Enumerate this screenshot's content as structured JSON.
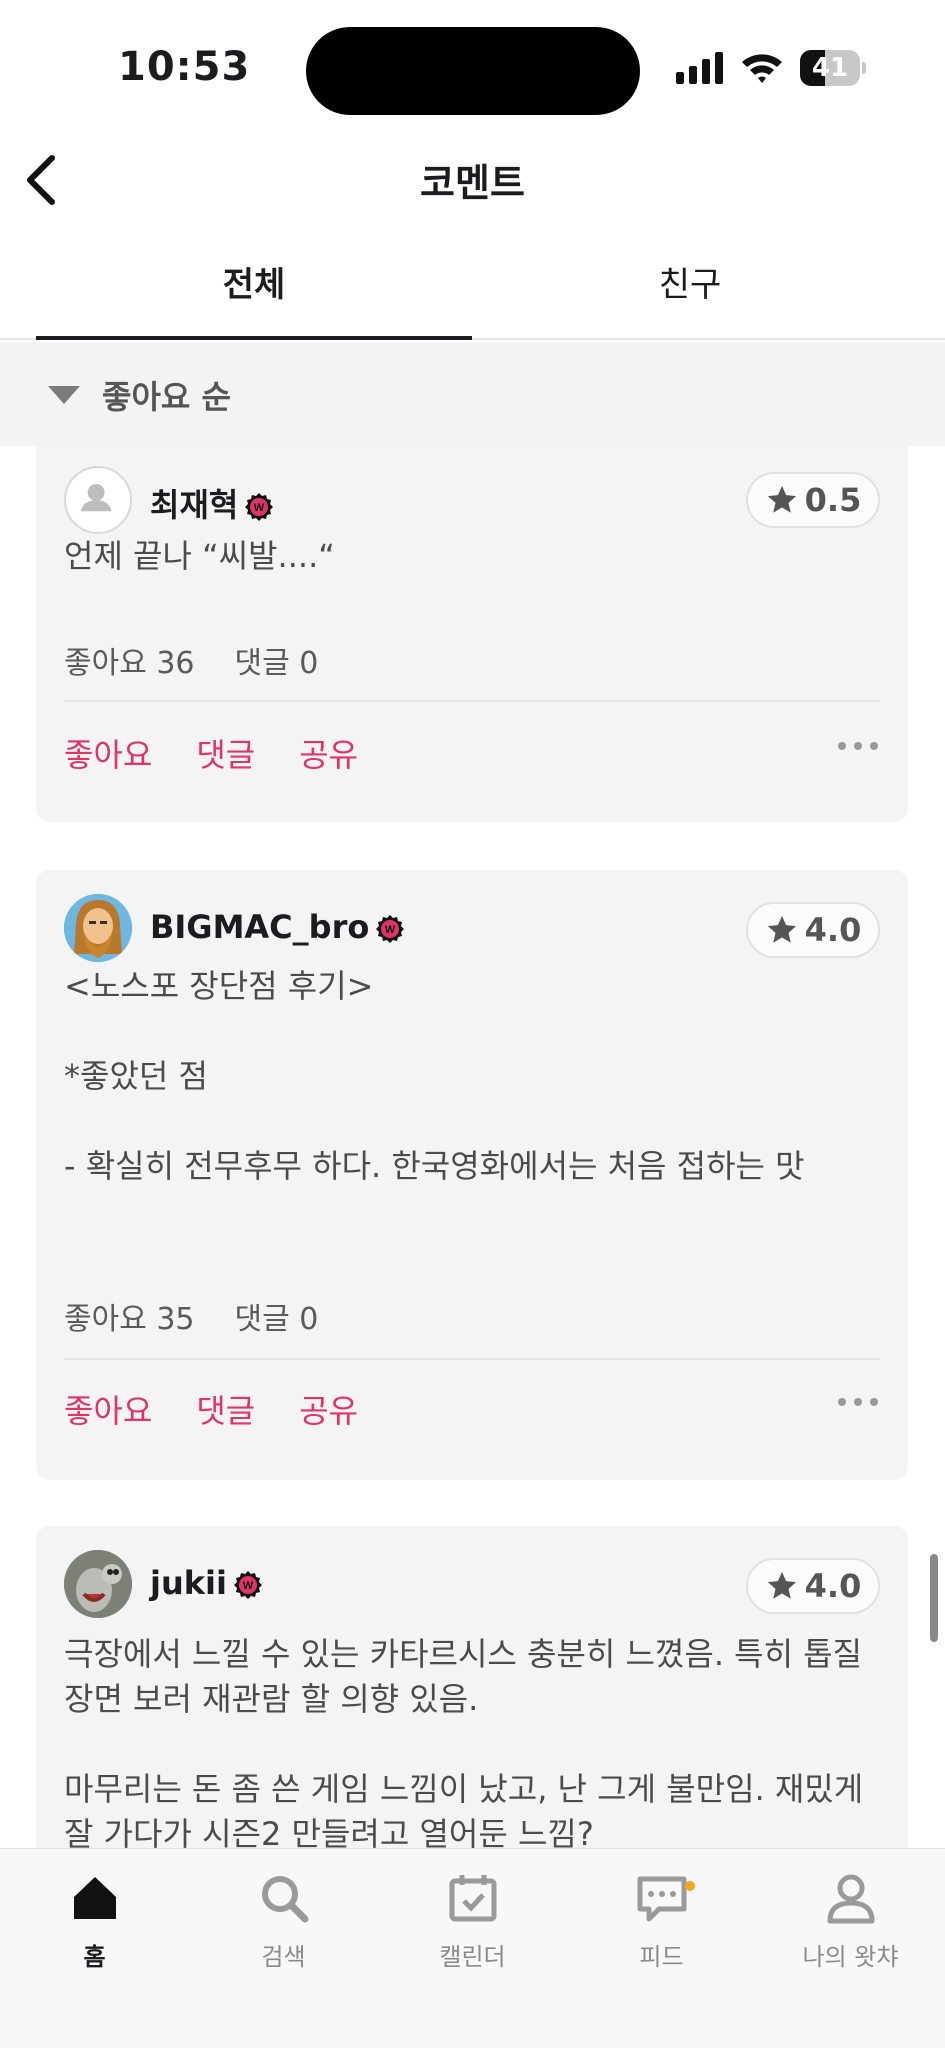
{
  "status_bar": {
    "time": "10:53",
    "battery": "41",
    "battery_level": 0.41
  },
  "header": {
    "title": "코멘트",
    "back_icon": "chevron-left-icon"
  },
  "tabs": [
    {
      "label": "전체",
      "active": true
    },
    {
      "label": "친구",
      "active": false
    }
  ],
  "sort": {
    "label": "좋아요 순"
  },
  "comments": [
    {
      "username": "최재혁",
      "rating": "0.5",
      "text": "언제 끝나 “씨발....“",
      "likes_label": "좋아요 36",
      "replies_label": "댓글 0"
    },
    {
      "username": "BIGMAC_bro",
      "rating": "4.0",
      "text": "<노스포 장단점 후기>\n\n*좋았던 점\n\n- 확실히 전무후무 하다. 한국영화에서는 처음 접하는 맛",
      "likes_label": "좋아요 35",
      "replies_label": "댓글 0"
    },
    {
      "username": "jukii",
      "rating": "4.0",
      "text": "극장에서 느낄 수 있는 카타르시스 충분히 느꼈음. 특히 톱질 장면 보러 재관람 할 의향 있음.\n\n마무리는 돈 좀 쓴 게임 느낌이 났고, 난 그게 불만임. 재밌게 잘 가다가 시즌2 만들려고 열어둔 느낌?"
    }
  ],
  "actions": {
    "like": "좋아요",
    "reply": "댓글",
    "share": "공유"
  },
  "bottom_nav": [
    {
      "label": "홈",
      "icon": "home-icon",
      "active": true
    },
    {
      "label": "검색",
      "icon": "search-icon",
      "active": false
    },
    {
      "label": "캘린더",
      "icon": "calendar-icon",
      "active": false
    },
    {
      "label": "피드",
      "icon": "chat-icon",
      "active": false
    },
    {
      "label": "나의 왓챠",
      "icon": "person-icon",
      "active": false
    }
  ],
  "colors": {
    "accent": "#e0336a",
    "badge": "#e0336a",
    "notification_dot": "#f5a623"
  }
}
